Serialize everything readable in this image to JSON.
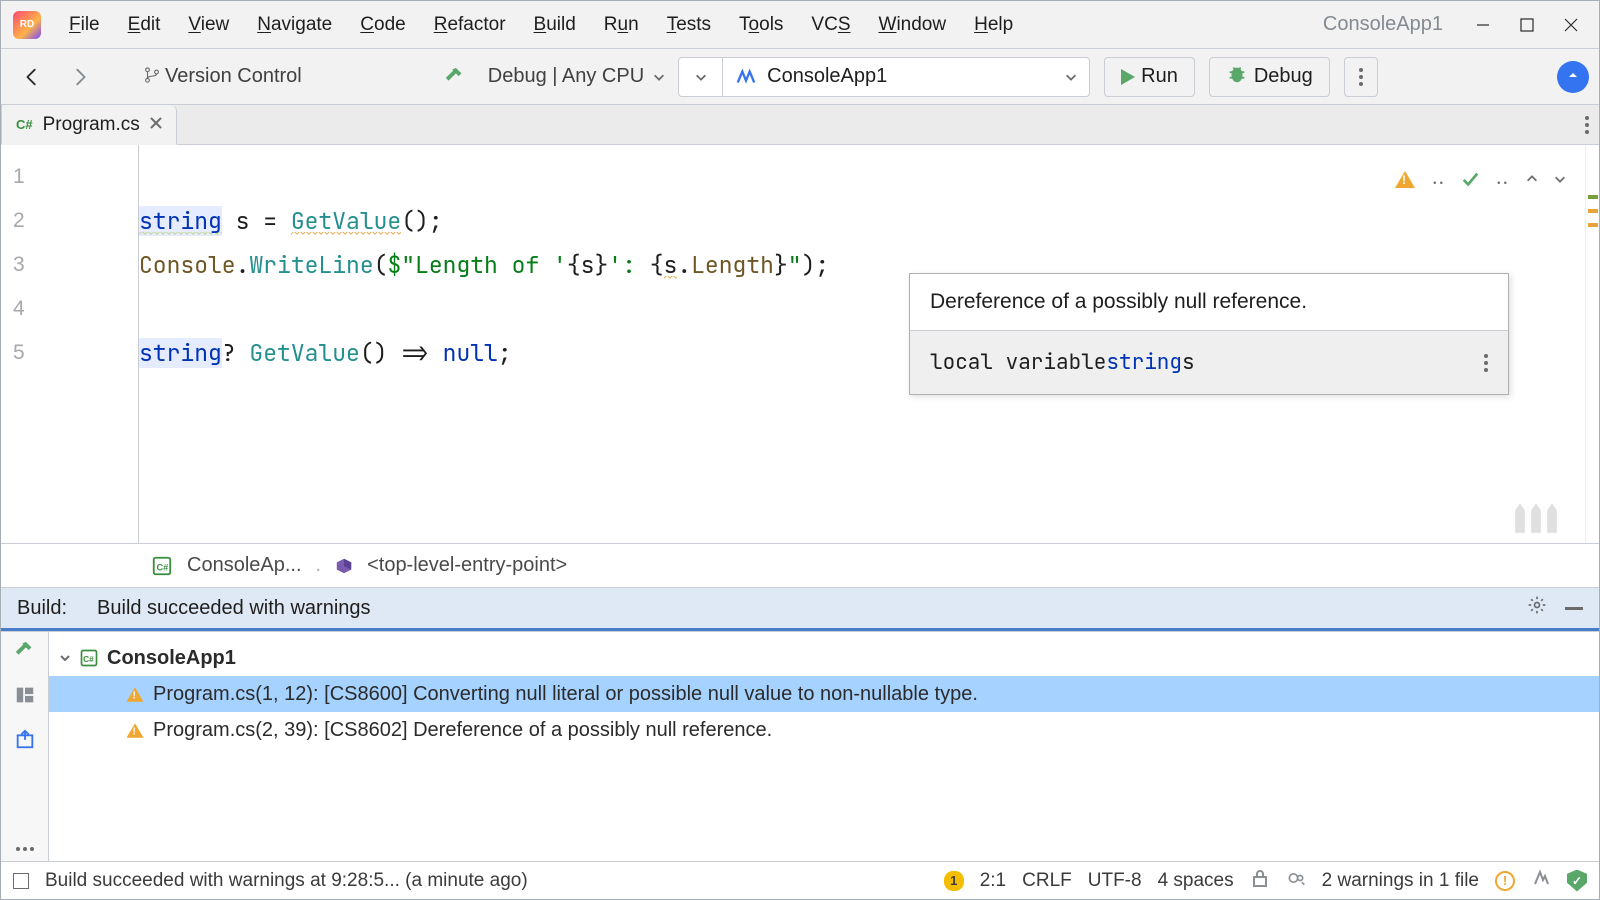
{
  "window": {
    "title": "ConsoleApp1"
  },
  "menu": [
    "File",
    "Edit",
    "View",
    "Navigate",
    "Code",
    "Refactor",
    "Build",
    "Run",
    "Tests",
    "Tools",
    "VCS",
    "Window",
    "Help"
  ],
  "toolbar": {
    "vcs": "Version Control",
    "config": "Debug | Any CPU",
    "project": "ConsoleApp1",
    "run": "Run",
    "debug": "Debug"
  },
  "tab": {
    "lang": "C#",
    "name": "Program.cs"
  },
  "editor": {
    "lines": {
      "l2a": "string",
      "l2b": " s = ",
      "l2c": "GetValue",
      "l2d": "();",
      "l3a": "Console",
      "l3b": ".",
      "l3c": "WriteLine",
      "l3d": "(",
      "l3e": "$\"Length of '",
      "l3f": "{",
      "l3g": "s",
      "l3h": "}",
      "l3i": "': ",
      "l3j": "{",
      "l3k": "s",
      "l3l": ".",
      "l3m": "Length",
      "l3n": "}",
      "l3o": "\"",
      "l3p": ");",
      "l5a": "string",
      "l5b": "? ",
      "l5c": "GetValue",
      "l5d": "() => ",
      "l5e": "null",
      "l5f": ";"
    }
  },
  "tooltip": {
    "msg": "Dereference of a possibly null reference.",
    "row2a": "local variable ",
    "row2b": "string",
    "row2c": " s"
  },
  "crumbs": {
    "proj": "ConsoleAp...",
    "entry": "<top-level-entry-point>"
  },
  "build": {
    "label": "Build:",
    "status": "Build succeeded with warnings",
    "root": "ConsoleApp1",
    "warn1": "Program.cs(1, 12): [CS8600] Converting null literal or possible null value to non-nullable type.",
    "warn2": "Program.cs(2, 39): [CS8602] Dereference of a possibly null reference."
  },
  "status": {
    "msg": "Build succeeded with warnings at 9:28:5... (a minute ago)",
    "notif": "1",
    "pos": "2:1",
    "eol": "CRLF",
    "enc": "UTF-8",
    "indent": "4 spaces",
    "insp": "2 warnings in 1 file"
  }
}
